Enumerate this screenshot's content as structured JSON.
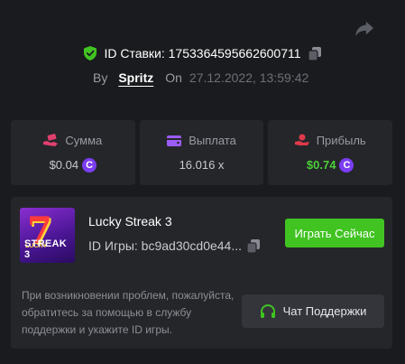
{
  "header": {
    "bet_id_label": "ID Ставки: 1753364595662600711",
    "by_label": "By",
    "username": "Spritz",
    "on_label": "On",
    "date": "27.12.2022, 13:59:42"
  },
  "stats": {
    "amount": {
      "label": "Сумма",
      "value": "$0.04",
      "icon": "money-hand-icon",
      "coin": "C"
    },
    "payout": {
      "label": "Выплата",
      "value": "16.016 x",
      "icon": "wallet-icon"
    },
    "profit": {
      "label": "Прибыль",
      "value": "$0.74",
      "icon": "profit-hand-icon",
      "coin": "C"
    }
  },
  "game": {
    "title": "Lucky Streak 3",
    "id_label": "ID Игры: bc9ad30cd0e44...",
    "thumb_caption_top": "LUCKY",
    "thumb_caption_bottom": "STREAK 3",
    "thumb_symbol": "7",
    "play_button": "Играть Сейчас"
  },
  "support": {
    "help_text": "При возникновении проблем, пожалуйста, обратитесь за помощью в службу поддержки и укажите ID игры.",
    "button_label": "Чат Поддержки"
  },
  "colors": {
    "background": "#1a1b1e",
    "card": "#25262a",
    "accent_green": "#41c322",
    "profit_green": "#4ccf3a",
    "coin_purple": "#7b3df2",
    "amount_icon": "#e0406e",
    "payout_icon": "#9b5cf6",
    "profit_icon": "#e03a4a"
  }
}
